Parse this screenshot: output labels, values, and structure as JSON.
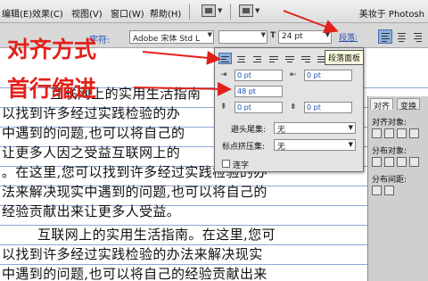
{
  "menubar": {
    "items": [
      "编辑(E)",
      "效果(C)",
      "视图(V)",
      "窗口(W)",
      "帮助(H)"
    ],
    "workspace_title": "美妆于 Photosh"
  },
  "optionsbar": {
    "char_label": "字符:",
    "font_family": "Adobe 宋体 Std L",
    "font_size": "24 pt",
    "paragraph_label": "段落:"
  },
  "annotations": {
    "align": "对齐方式",
    "indent": "首行缩进"
  },
  "document": {
    "lines": [
      "互联网上的实用生活指南",
      "以找到许多经过实践检验的办",
      "中遇到的问题,也可以将自己的",
      "让更多人因之受益互联网上的",
      "。在这里,您可以找到许多经过实践检验的办",
      "法来解决现实中遇到的问题,也可以将自己的",
      "经验贡献出来让更多人受益。",
      "互联网上的实用生活指南。在这里,您可",
      "以找到许多经过实践检验的办法来解决现实",
      "中遇到的问题,也可以将自己的经验贡献出来"
    ]
  },
  "paragraph_panel": {
    "tooltip": "段落面板",
    "left_indent": "0 pt",
    "right_indent": "0 pt",
    "first_indent": "48 pt",
    "space_before": "0 pt",
    "space_after": "0 pt",
    "kinsoku_label": "避头尾集:",
    "kinsoku_value": "无",
    "mojikumi_label": "标点挤压集:",
    "mojikumi_value": "无",
    "hyphen_label": "连字"
  },
  "right_panel": {
    "tabs": [
      "对齐",
      "变换"
    ],
    "align_objects_label": "对齐对象:",
    "distribute_objects_label": "分布对象:",
    "distribute_spacing_label": "分布间距:"
  }
}
